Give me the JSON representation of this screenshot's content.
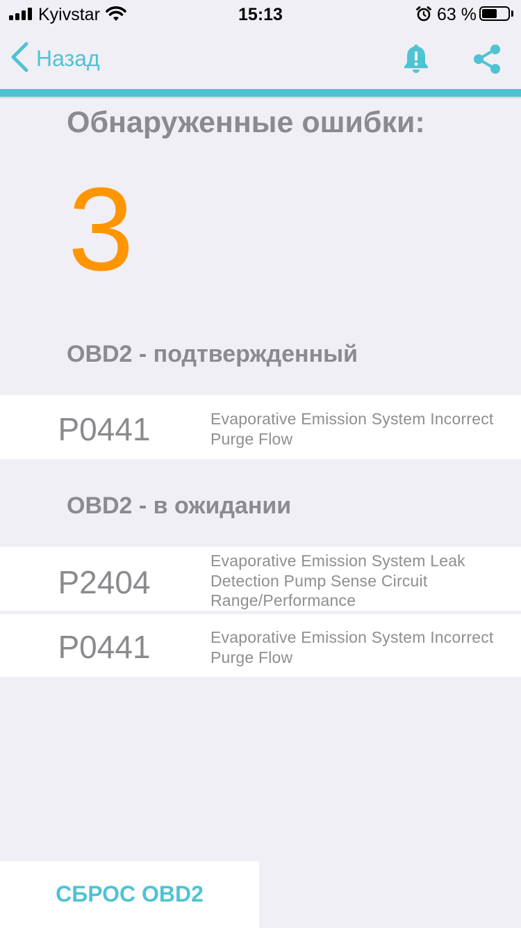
{
  "status_bar": {
    "carrier": "Kyivstar",
    "time": "15:13",
    "battery_percent": "63 %",
    "battery_level": 0.63
  },
  "nav": {
    "back_label": "Назад",
    "bell_icon": "bell-alert-icon",
    "share_icon": "share-icon",
    "accent_color": "#4ec0d1"
  },
  "summary": {
    "title": "Обнаруженные ошибки:",
    "count": "3",
    "count_color": "#ff9500"
  },
  "sections": [
    {
      "header": "OBD2 - подтвержденный",
      "codes": [
        {
          "code": "P0441",
          "description": "Evaporative Emission System Incorrect Purge Flow"
        }
      ]
    },
    {
      "header": "OBD2 - в ожидании",
      "codes": [
        {
          "code": "P2404",
          "description": "Evaporative Emission System Leak Detection Pump Sense Circuit Range/Performance"
        },
        {
          "code": "P0441",
          "description": "Evaporative Emission System Incorrect Purge Flow"
        }
      ]
    }
  ],
  "footer": {
    "reset_label": "СБРОС OBD2"
  }
}
